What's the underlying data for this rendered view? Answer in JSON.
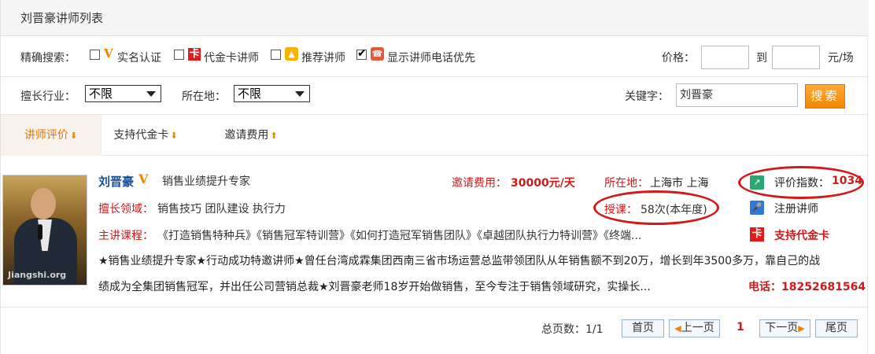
{
  "title": "刘晋豪讲师列表",
  "filters": {
    "precise_label": "精确搜索：",
    "options": [
      {
        "label": "实名认证",
        "checked": false,
        "icon": "verified-v-icon"
      },
      {
        "label": "代金卡讲师",
        "checked": false,
        "icon": "voucher-card-icon"
      },
      {
        "label": "推荐讲师",
        "checked": false,
        "icon": "thumbs-up-icon"
      },
      {
        "label": "显示讲师电话优先",
        "checked": true,
        "icon": "phone-icon"
      }
    ],
    "price_label": "价格：",
    "price_to": "到",
    "price_unit": "元/场",
    "price_min": "",
    "price_max": "",
    "industry_label": "擅长行业：",
    "industry_value": "不限",
    "location_label": "所在地：",
    "location_value": "不限",
    "keyword_label": "关键字：",
    "keyword_value": "刘晋豪",
    "search_button": "搜索"
  },
  "tabs": [
    {
      "label": "讲师评价",
      "arrow": "down",
      "active": true
    },
    {
      "label": "支持代金卡",
      "arrow": "down",
      "active": false
    },
    {
      "label": "邀请费用",
      "arrow": "up",
      "active": false
    }
  ],
  "lecturer": {
    "name": "刘晋豪",
    "v_badge": "V",
    "subtitle": "销售业绩提升专家",
    "fee_label": "邀请费用：",
    "fee_value": "30000元/天",
    "location_label": "所在地：",
    "location_value": "上海市 上海",
    "score_label": "评价指数：",
    "score_value": "1034",
    "skill_label": "擅长领域：",
    "skill_value": "销售技巧 团队建设 执行力",
    "lesson_label": "授课：",
    "lesson_value": "58次(本年度)",
    "register_label": "注册讲师",
    "course_label": "主讲课程：",
    "course_value": "《打造销售特种兵》《销售冠军特训营》《如何打造冠军销售团队》《卓越团队执行力特训营》《终端...",
    "card_label": "支持代金卡",
    "desc_line1": "★销售业绩提升专家★行动成功特邀讲师★曾任台湾成霖集团西南三省市场运营总监带领团队从年销售额不到20万，增长到年3500多万，靠自己的战",
    "desc_line2": "绩成为全集团销售冠军，并出任公司营销总裁★刘晋豪老师18岁开始做销售，至今专注于销售领域研究，实操长...",
    "phone": "电话：18252681564",
    "photo_watermark": "Jiangshi.org"
  },
  "pager": {
    "total": "总页数：1/1",
    "first": "首页",
    "prev": "上一页",
    "current": "1",
    "next": "下一页",
    "last": "尾页"
  },
  "colors": {
    "accent_orange": "#f08300",
    "highlight_red": "#d11a1a",
    "name_blue": "#1a4f9a"
  }
}
